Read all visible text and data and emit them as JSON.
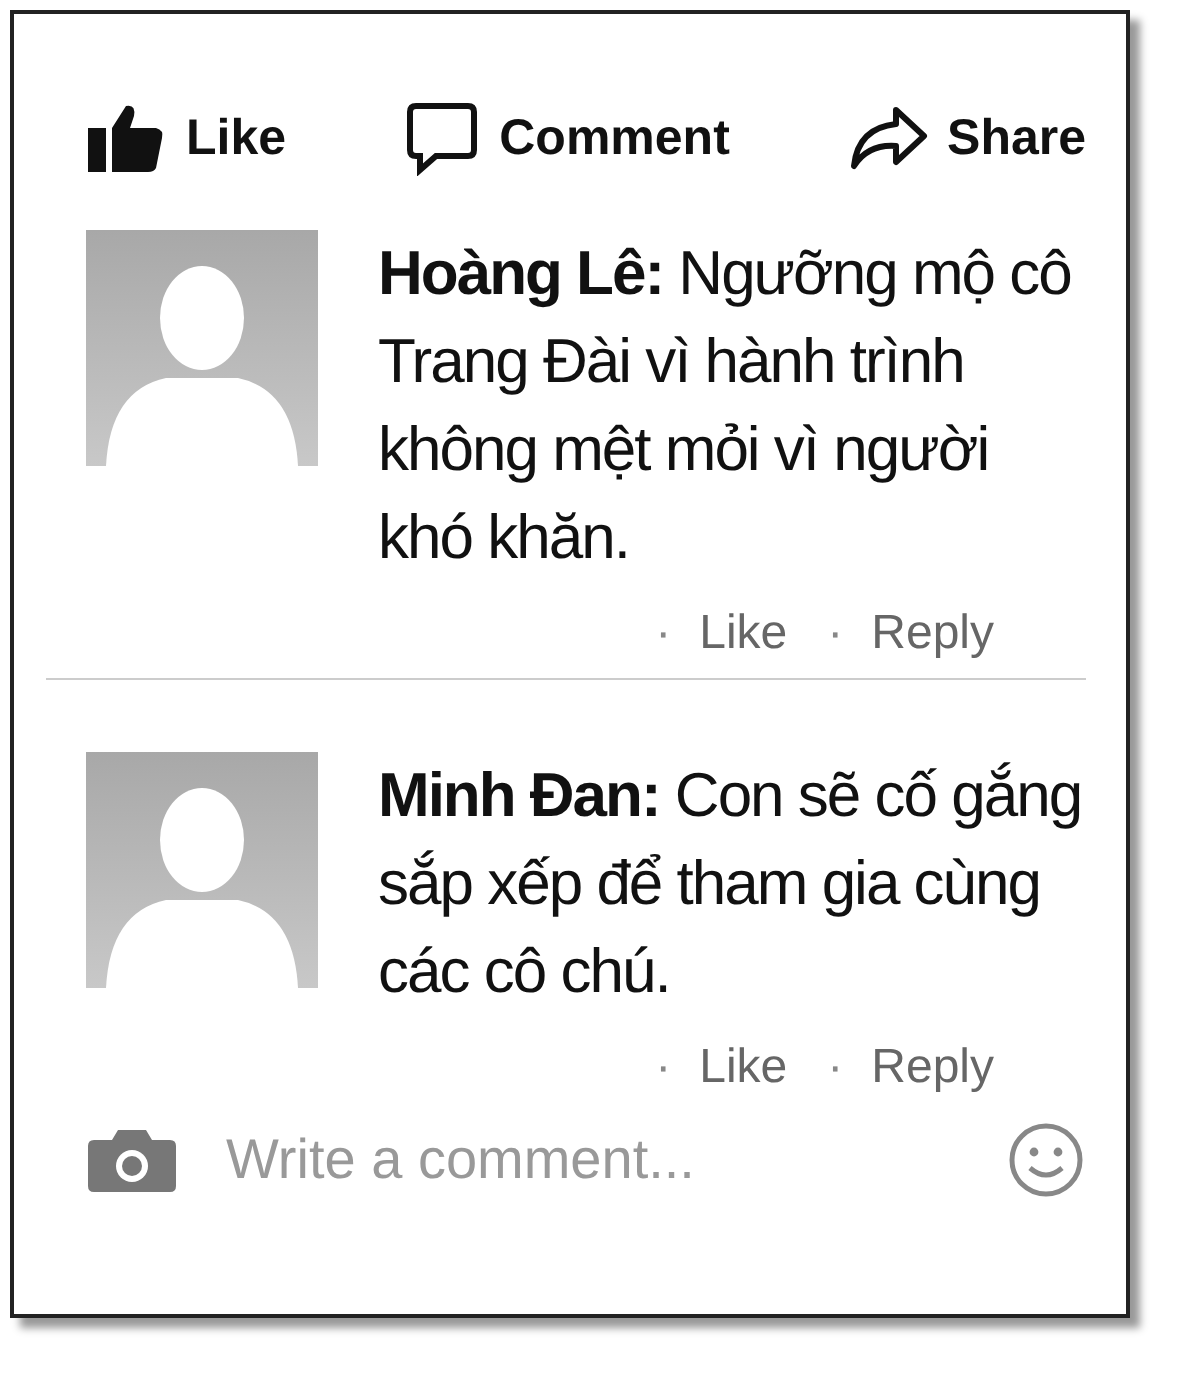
{
  "actions": [
    {
      "kind": "like",
      "label": "Like"
    },
    {
      "kind": "comment",
      "label": "Comment"
    },
    {
      "kind": "share",
      "label": "Share"
    }
  ],
  "comments": [
    {
      "text": "**Hoàng Lê:** Ngưỡng mộ cô Trang Đài vì hành trình không mệt mỏi vì người khó khăn.",
      "links": [
        {
          "dot": "·",
          "label": "Like"
        },
        {
          "dot": "·",
          "label": "Reply"
        }
      ]
    },
    {
      "text": "**Minh Đan:** Con sẽ cố gắng sắp xếp để tham gia cùng các cô chú.",
      "links": [
        {
          "dot": "·",
          "label": "Like"
        },
        {
          "dot": "·",
          "label": "Reply"
        }
      ]
    }
  ],
  "composer": {
    "placeholder": "Write a comment..."
  }
}
